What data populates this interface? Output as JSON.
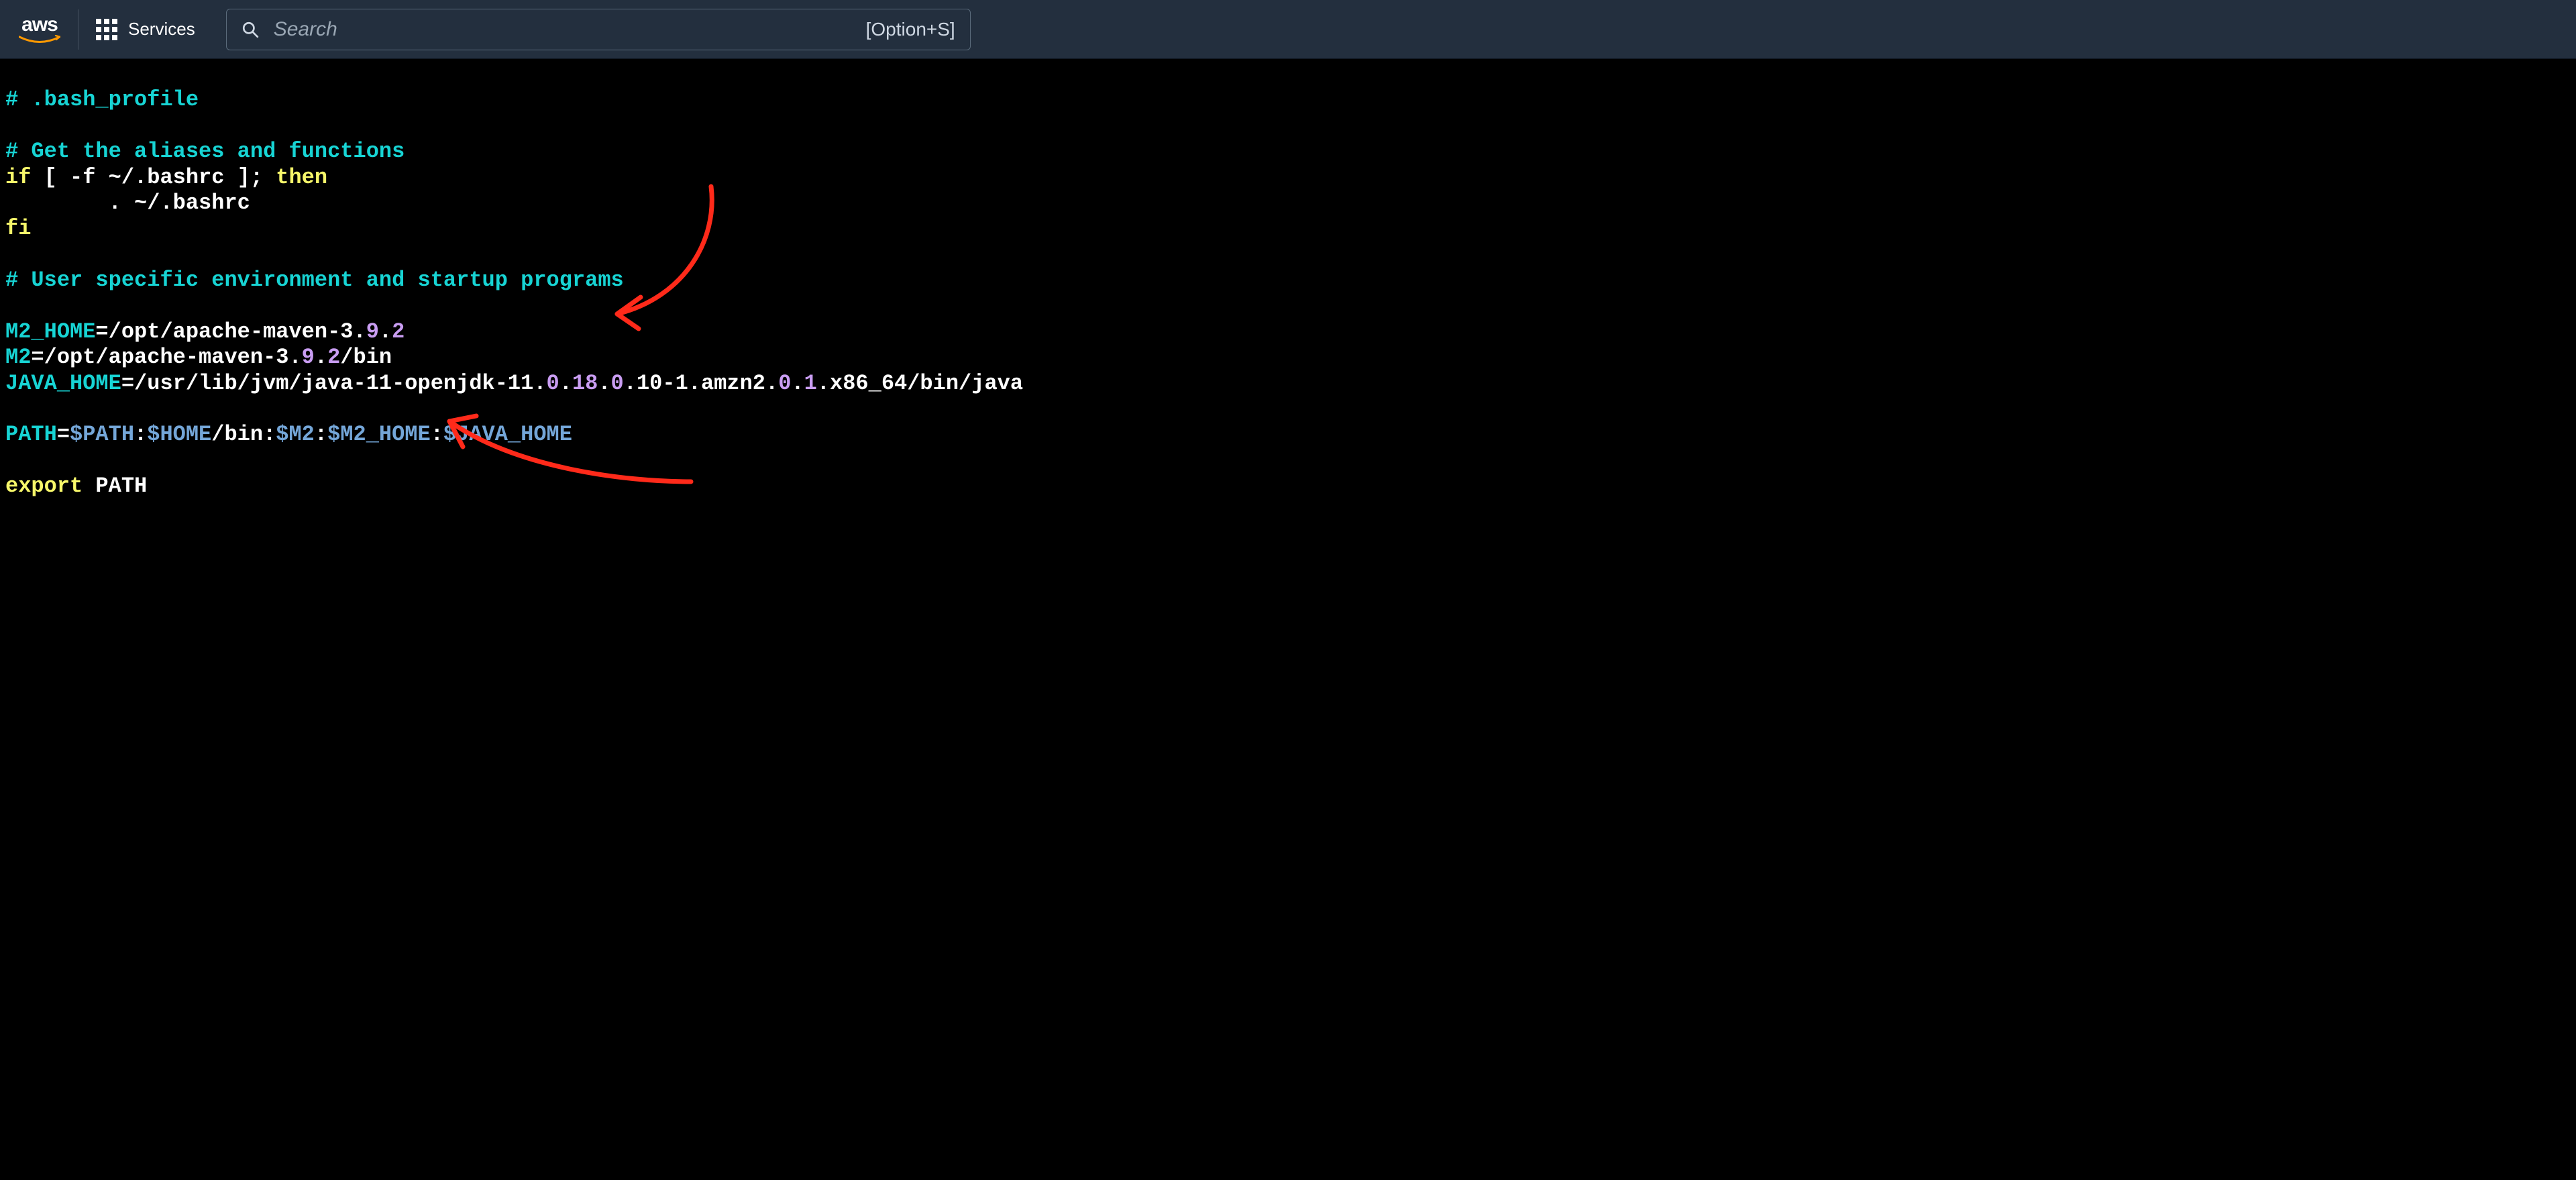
{
  "navbar": {
    "logo_text": "aws",
    "services_label": "Services",
    "search_placeholder": "Search",
    "search_shortcut": "[Option+S]"
  },
  "code": {
    "c1": "# .bash_profile",
    "c2": "# Get the aliases and functions",
    "kw_if": "if",
    "cond_open": " [ -f ~/.bashrc ]; ",
    "kw_then": "then",
    "source_line": "        . ~/.bashrc",
    "kw_fi": "fi",
    "c3": "# User specific environment and startup programs",
    "m2home_var": "M2_HOME",
    "m2home_eq": "=/opt/apache-maven-3.",
    "m2home_n1": "9",
    "m2home_mid": ".",
    "m2home_n2": "2",
    "m2_var": "M2",
    "m2_eq": "=/opt/apache-maven-3.",
    "m2_n1": "9",
    "m2_mid": ".",
    "m2_n2": "2",
    "m2_tail": "/bin",
    "jh_var": "JAVA_HOME",
    "jh_p1": "=/usr/lib/jvm/java-11-openjdk-11.",
    "jh_n1": "0",
    "jh_p2": ".",
    "jh_n2": "18",
    "jh_p3": ".",
    "jh_n3": "0",
    "jh_p4": ".10-1.amzn2.",
    "jh_n4": "0",
    "jh_p5": ".",
    "jh_n5": "1",
    "jh_p6": ".x86_64/bin/java",
    "path_var": "PATH",
    "path_eq": "=",
    "path_ref1": "$PATH",
    "path_colon1": ":",
    "path_ref2": "$HOME",
    "path_bin": "/bin:",
    "path_ref3": "$M2",
    "path_colon3": ":",
    "path_ref4": "$M2_HOME",
    "path_colon4": ":",
    "path_ref5": "$JAVA_HOME",
    "kw_export": "export",
    "export_tail": " PATH"
  }
}
